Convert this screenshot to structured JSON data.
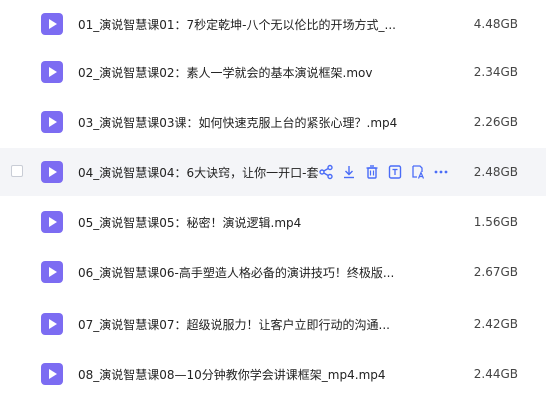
{
  "accent_color": "#7C6CF2",
  "action_icon_color": "#4A6CF7",
  "files": [
    {
      "name": "01_演说智慧课01：7秒定乾坤-八个无以伦比的开场方式_...",
      "size": "4.48GB"
    },
    {
      "name": "02_演说智慧课02：素人一学就会的基本演说框架.mov",
      "size": "2.34GB"
    },
    {
      "name": "03_演说智慧课03课：如何快速克服上台的紧张心理？.mp4",
      "size": "2.26GB"
    },
    {
      "name": "04_演说智慧课04：6大诀窍，让你一开口-套",
      "size": "2.48GB",
      "hovered": true,
      "actions": [
        "share-icon",
        "download-icon",
        "delete-icon",
        "extract-text-icon",
        "translate-icon",
        "more-icon"
      ]
    },
    {
      "name": "05_演说智慧课05：秘密！演说逻辑.mp4",
      "size": "1.56GB"
    },
    {
      "name": "06_演说智慧课06-高手塑造人格必备的演讲技巧！终极版...",
      "size": "2.67GB"
    },
    {
      "name": "07_演说智慧课07：超级说服力！让客户立即行动的沟通...",
      "size": "2.42GB"
    },
    {
      "name": "08_演说智慧课08—10分钟教你学会讲课框架_mp4.mp4",
      "size": "2.44GB"
    }
  ]
}
